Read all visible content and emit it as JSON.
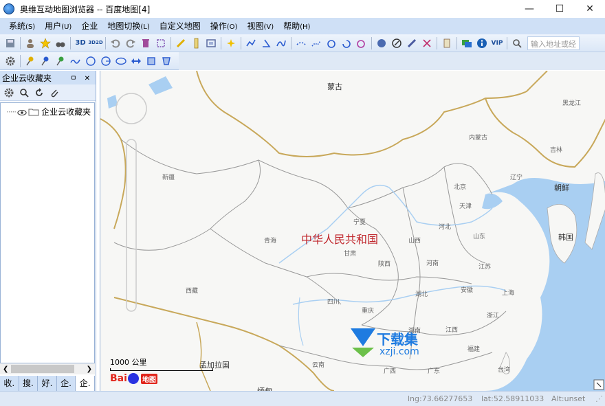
{
  "window": {
    "title": "奥维互动地图浏览器 -- 百度地图[4]",
    "min_glyph": "—",
    "max_glyph": "☐",
    "close_glyph": "✕"
  },
  "menu": [
    {
      "label": "系统",
      "acc": "(S)"
    },
    {
      "label": "用户",
      "acc": "(U)"
    },
    {
      "label": "企业",
      "acc": ""
    },
    {
      "label": "地图切换",
      "acc": "(L)"
    },
    {
      "label": "自定义地图",
      "acc": ""
    },
    {
      "label": "操作",
      "acc": "(O)"
    },
    {
      "label": "视图",
      "acc": "(V)"
    },
    {
      "label": "帮助",
      "acc": "(H)"
    }
  ],
  "toolbar": {
    "btn_3d": "3D",
    "btn_3d2d": "3D2D",
    "btn_vip": "VIP",
    "address_placeholder": "输入地址或经"
  },
  "panel": {
    "title": "企业云收藏夹",
    "header_buttons": "ㅁ ✕",
    "tree_item": "企业云收藏夹"
  },
  "bottom_tabs": [
    "收.",
    "搜.",
    "好.",
    "企.",
    "企."
  ],
  "map": {
    "labels": {
      "mongolia": "蒙古",
      "heilongjiang": "黑龙江",
      "neimenggu": "内蒙古",
      "jilin": "吉林",
      "xinjiang": "新疆",
      "liaoning": "辽宁",
      "chaoxian": "朝鲜",
      "beijing": "北京",
      "tianjin": "天津",
      "hebei": "河北",
      "ningxia": "宁夏",
      "shanxi": "山西",
      "shandong": "山东",
      "qinghai": "青海",
      "gansu": "甘肃",
      "shaanxi": "陕西",
      "henan": "河南",
      "hanguo": "韩国",
      "jiangsu": "江苏",
      "xizang": "西藏",
      "anhui": "安徽",
      "shanghai": "上海",
      "hubei": "湖北",
      "sichuan": "四川",
      "chongqing": "重庆",
      "zhejiang": "浙江",
      "hunan": "湖南",
      "jiangxi": "江西",
      "fujian": "福建",
      "yunnan": "云南",
      "guangxi": "广西",
      "guangdong": "广东",
      "taiwan": "台湾",
      "mengjiala": "孟加拉国",
      "miandian": "缅甸"
    },
    "country_label": "中华人民共和国",
    "scale_label": "1000 公里",
    "logo_bai": "Bai",
    "logo_du": "du",
    "logo_map": "地图",
    "watermark_main": "下载集",
    "watermark_sub": "xzji.com"
  },
  "status": {
    "lng": "lng:73.66277653",
    "lat": "lat:52.58911033",
    "alt": "Alt:unset"
  },
  "colors": {
    "border_gold": "#c8a85a",
    "water": "#a9cff2",
    "menubar": "#cfe0f6",
    "country_red": "#c0262c"
  }
}
